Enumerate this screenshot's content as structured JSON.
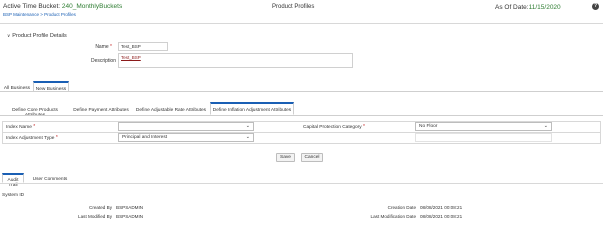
{
  "header": {
    "bucket_label": "Active Time Bucket:",
    "bucket_value": "240_MonthlyBuckets",
    "breadcrumb": "BSP Maintenance > Product Profiles",
    "page_title": "Product Profiles",
    "as_of_label": "As Of Date:",
    "as_of_value": "11/15/2020",
    "help_glyph": "?"
  },
  "details": {
    "section_title": "Product Profile Details",
    "name_label": "Name",
    "name_value": "Test_BSP",
    "description_label": "Description",
    "description_value": "Test_BSP"
  },
  "tabs": [
    {
      "label": "All Business"
    },
    {
      "label": "New Business"
    }
  ],
  "subtabs": [
    {
      "label": "Define Core Products Attributes"
    },
    {
      "label": "Define Payment Attributes"
    },
    {
      "label": "Define Adjustable Rate Attributes"
    },
    {
      "label": "Define Inflation Adjustment Attributes"
    }
  ],
  "form": {
    "index_name_label": "Index Name",
    "index_name_value": "",
    "index_adj_label": "Index Adjustment Type",
    "index_adj_value": "Principal and Interest",
    "cap_prot_label": "Capital Protection Category",
    "cap_prot_value": "No Floor"
  },
  "buttons": {
    "save": "Save",
    "cancel": "Cancel"
  },
  "bottom_tabs": [
    {
      "label": "Audit Trail"
    },
    {
      "label": "User Comments"
    }
  ],
  "audit": {
    "system_id_label": "System ID",
    "created_by_label": "Created By",
    "created_by_value": "BSPSADMIN",
    "last_modified_by_label": "Last Modified By",
    "last_modified_by_value": "BSPSADMIN",
    "creation_date_label": "Creation Date",
    "creation_date_value": "08/08/2021 00:08:21",
    "last_mod_date_label": "Last Modification Date",
    "last_mod_date_value": "08/08/2021 00:08:21"
  },
  "colors": {
    "accent": "#1a5fb4",
    "green": "#2e7d32",
    "required": "#c62828"
  }
}
